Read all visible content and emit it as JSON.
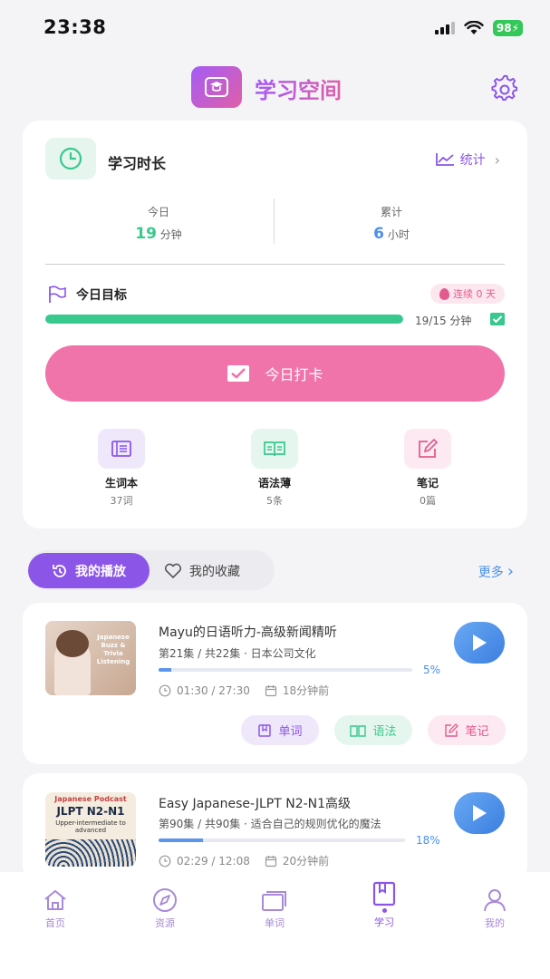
{
  "status_bar": {
    "time": "23:38",
    "battery": "98"
  },
  "header": {
    "title": "学习空间"
  },
  "study_card": {
    "title": "学习时长",
    "stats_link": "统计",
    "today": {
      "label": "今日",
      "value": "19",
      "unit": "分钟"
    },
    "total": {
      "label": "累计",
      "value": "6",
      "unit": "小时"
    },
    "goal": {
      "title": "今日目标",
      "streak": "连续 0 天",
      "progress_text": "19/15 分钟",
      "progress_fraction": 1.0
    },
    "checkin_label": "今日打卡",
    "tools": [
      {
        "name": "生词本",
        "count": "37词",
        "icon": "vocab-book-icon"
      },
      {
        "name": "语法薄",
        "count": "5条",
        "icon": "grammar-book-icon"
      },
      {
        "name": "笔记",
        "count": "0篇",
        "icon": "note-edit-icon"
      }
    ]
  },
  "tabs": {
    "active": "我的播放",
    "inactive": "我的收藏",
    "more": "更多"
  },
  "episodes": [
    {
      "title": "Mayu的日语听力-高级新闻精听",
      "meta": "第21集 / 共22集 · 日本公司文化",
      "progress": 0.05,
      "progress_label": "5%",
      "time": "01:30 / 27:30",
      "ago": "18分钟前",
      "thumb_text": "Japanese Buzz & Trivia Listening",
      "chips": [
        "单词",
        "语法",
        "笔记"
      ]
    },
    {
      "title": "Easy Japanese-JLPT N2-N1高级",
      "meta": "第90集 / 共90集 · 适合自己的规则优化的魔法",
      "progress": 0.18,
      "progress_label": "18%",
      "time": "02:29 / 12:08",
      "ago": "20分钟前",
      "thumb_top": "Japanese Podcast",
      "thumb_main": "JLPT N2-N1",
      "thumb_sub": "Upper-intermediate to advanced"
    }
  ],
  "bottom_nav": [
    {
      "label": "首页",
      "icon": "home-icon"
    },
    {
      "label": "资源",
      "icon": "compass-icon"
    },
    {
      "label": "单词",
      "icon": "cards-icon"
    },
    {
      "label": "学习",
      "icon": "book-icon",
      "active": true
    },
    {
      "label": "我的",
      "icon": "profile-icon"
    }
  ],
  "colors": {
    "accent": "#8b56e8",
    "green": "#37c98d",
    "pink": "#f073aa",
    "blue": "#4c8fe6"
  }
}
